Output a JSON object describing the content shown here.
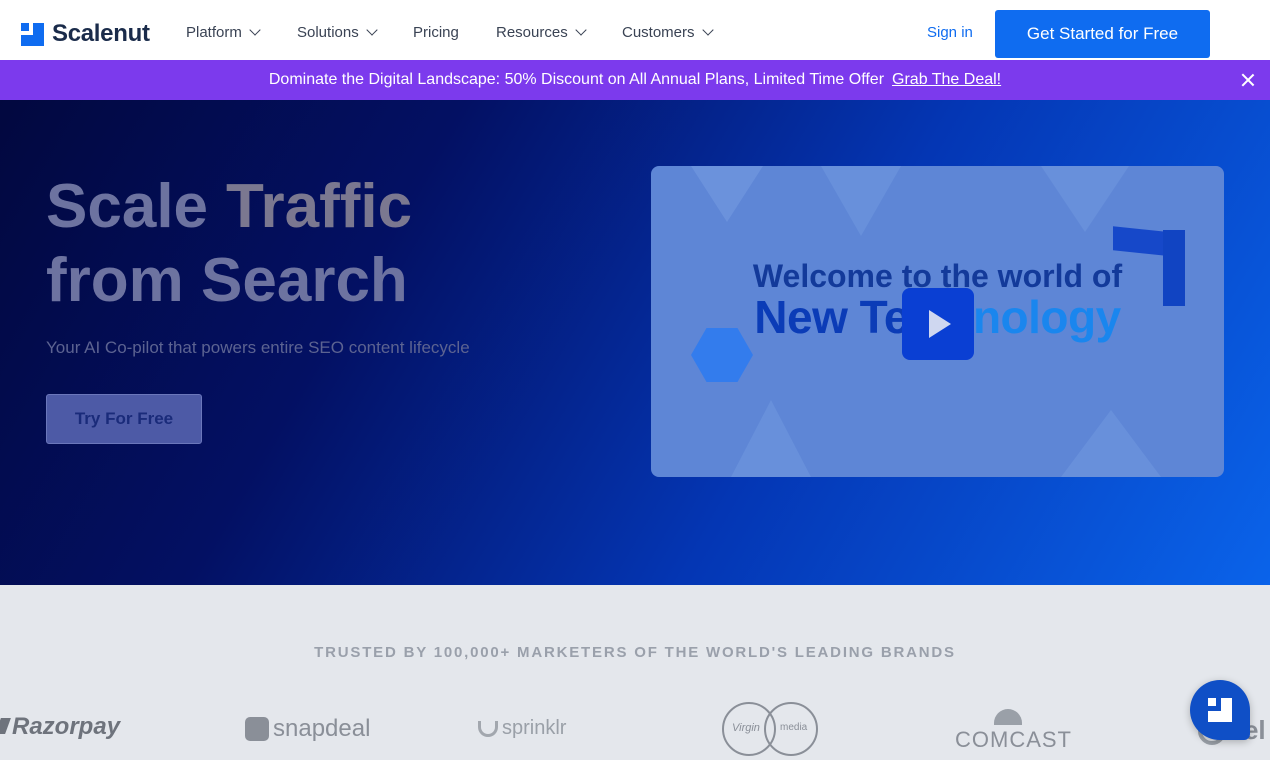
{
  "brand": {
    "name": "Scalenut",
    "accent": "#0f6cf0",
    "promo_color": "#7c3aed"
  },
  "nav": {
    "items": [
      {
        "label": "Platform",
        "dropdown": true
      },
      {
        "label": "Solutions",
        "dropdown": true
      },
      {
        "label": "Pricing",
        "dropdown": false
      },
      {
        "label": "Resources",
        "dropdown": true
      },
      {
        "label": "Customers",
        "dropdown": true
      }
    ],
    "sign_in": "Sign in",
    "cta": "Get Started for Free"
  },
  "promo": {
    "text": "Dominate the Digital Landscape: 50% Discount on All Annual Plans, Limited Time Offer",
    "link": "Grab The Deal!",
    "close_icon": "close-icon"
  },
  "hero": {
    "title_line1_a": "Scale",
    "title_line1_b": "Traffic",
    "title_line2": "from Search",
    "subtitle": "Your AI Co-pilot that powers entire SEO content lifecycle",
    "cta": "Try For Free",
    "video": {
      "line1": "Welcome to the world of",
      "line2_a": "New Te",
      "line2_b": "nology",
      "play_icon": "play-icon"
    }
  },
  "brands": {
    "title": "TRUSTED BY 100,000+ MARKETERS OF THE WORLD'S LEADING BRANDS",
    "razorpay": "Razorpay",
    "snapdeal": "snapdeal",
    "sprinklr": "sprinklr",
    "virgin_a": "Virgin",
    "virgin_b": "media",
    "comcast": "COMCAST",
    "tel": "Tel"
  },
  "chat_widget": {
    "icon": "chat-logo-icon"
  }
}
